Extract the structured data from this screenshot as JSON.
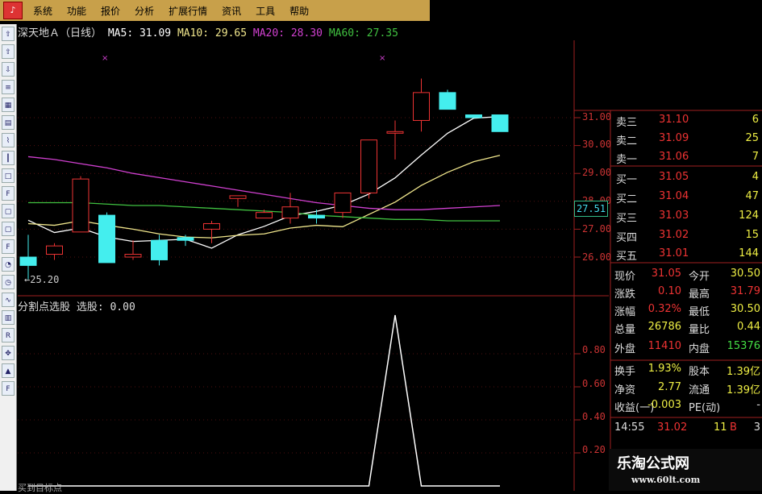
{
  "menu": {
    "items": [
      "系统",
      "功能",
      "报价",
      "分析",
      "扩展行情",
      "资讯",
      "工具",
      "帮助"
    ]
  },
  "chart_header": {
    "stock": "深天地Ａ（日线）",
    "ma5_label": "MA5:",
    "ma5": "31.09",
    "ma10_label": "MA10:",
    "ma10": "29.65",
    "ma20_label": "MA20:",
    "ma20": "28.30",
    "ma60_label": "MA60:",
    "ma60": "27.35",
    "colors": {
      "ma5": "#ffffff",
      "ma10": "#f0e68c",
      "ma20": "#d040d0",
      "ma60": "#40c040"
    }
  },
  "low_marker": "←25.20",
  "current_price_tag": "27.51",
  "price_axis": [
    "31.00",
    "30.00",
    "29.00",
    "28.00",
    "27.00",
    "26.00"
  ],
  "indicator": {
    "title": "分割点选股 选股: 0.00",
    "axis": [
      "0.80",
      "0.60",
      "0.40",
      "0.20"
    ]
  },
  "sub_title": "买到目标点",
  "chart_data": [
    {
      "type": "candlestick",
      "ohlc": [
        [
          26.0,
          26.8,
          25.2,
          25.7
        ],
        [
          26.1,
          26.5,
          25.9,
          26.4
        ],
        [
          26.9,
          28.9,
          26.9,
          28.8
        ],
        [
          27.5,
          27.6,
          25.8,
          25.8
        ],
        [
          26.0,
          26.6,
          25.9,
          26.1
        ],
        [
          26.6,
          26.8,
          25.7,
          25.9
        ],
        [
          26.7,
          26.8,
          26.4,
          26.6
        ],
        [
          27.0,
          27.3,
          26.5,
          27.2
        ],
        [
          28.1,
          28.2,
          27.8,
          28.2
        ],
        [
          27.4,
          27.7,
          27.4,
          27.6
        ],
        [
          27.4,
          28.3,
          27.2,
          27.8
        ],
        [
          27.5,
          27.7,
          27.2,
          27.4
        ],
        [
          27.6,
          28.3,
          27.4,
          28.3
        ],
        [
          28.3,
          30.1,
          28.1,
          30.2
        ],
        [
          30.5,
          30.9,
          29.5,
          30.5
        ],
        [
          30.9,
          32.4,
          30.5,
          31.9
        ],
        [
          31.9,
          32.0,
          31.3,
          31.3
        ],
        [
          31.1,
          31.1,
          31.0,
          31.0
        ],
        [
          31.1,
          31.1,
          30.5,
          30.5
        ]
      ],
      "ma_series": [
        {
          "name": "MA5",
          "color": "#ffffff"
        },
        {
          "name": "MA10",
          "color": "#f0e68c"
        },
        {
          "name": "MA20",
          "color": "#d040d0"
        },
        {
          "name": "MA60",
          "color": "#40c040"
        }
      ]
    },
    {
      "type": "line",
      "x": [
        0,
        1,
        2,
        3,
        4,
        5,
        6,
        7,
        8,
        9,
        10,
        11,
        12,
        13,
        14,
        15,
        16,
        17,
        18
      ],
      "values": [
        0,
        0,
        0,
        0,
        0,
        0,
        0,
        0,
        0,
        0,
        0,
        0,
        0,
        0,
        1,
        0,
        0,
        0,
        0
      ]
    }
  ],
  "quote_panel": {
    "sell": [
      {
        "label": "卖三",
        "price": "31.10",
        "vol": "6"
      },
      {
        "label": "卖二",
        "price": "31.09",
        "vol": "25"
      },
      {
        "label": "卖一",
        "price": "31.06",
        "vol": "7"
      }
    ],
    "buy": [
      {
        "label": "买一",
        "price": "31.05",
        "vol": "4"
      },
      {
        "label": "买二",
        "price": "31.04",
        "vol": "47"
      },
      {
        "label": "买三",
        "price": "31.03",
        "vol": "124"
      },
      {
        "label": "买四",
        "price": "31.02",
        "vol": "15"
      },
      {
        "label": "买五",
        "price": "31.01",
        "vol": "144"
      }
    ],
    "stats": [
      {
        "l1": "现价",
        "v1": "31.05",
        "l2": "今开",
        "v2": "30.50"
      },
      {
        "l1": "涨跌",
        "v1": "0.10",
        "l2": "最高",
        "v2": "31.79"
      },
      {
        "l1": "涨幅",
        "v1": "0.32%",
        "l2": "最低",
        "v2": "30.50"
      },
      {
        "l1": "总量",
        "v1": "26786",
        "l2": "量比",
        "v2": "0.44"
      },
      {
        "l1": "外盘",
        "v1": "11410",
        "l2": "内盘",
        "v2": "15376"
      },
      {
        "l1": "换手",
        "v1": "1.93%",
        "l2": "股本",
        "v2": "1.39亿"
      },
      {
        "l1": "净资",
        "v1": "2.77",
        "l2": "流通",
        "v2": "1.39亿"
      },
      {
        "l1": "收益(一)",
        "v1": "-0.003",
        "l2": "PE(动)",
        "v2": "-"
      }
    ],
    "tick": {
      "time": "14:55",
      "price": "31.02",
      "vol": "11",
      "side": "B",
      "num": "3"
    }
  },
  "watermark": {
    "title": "乐淘公式网",
    "url": "www.60lt.com"
  }
}
